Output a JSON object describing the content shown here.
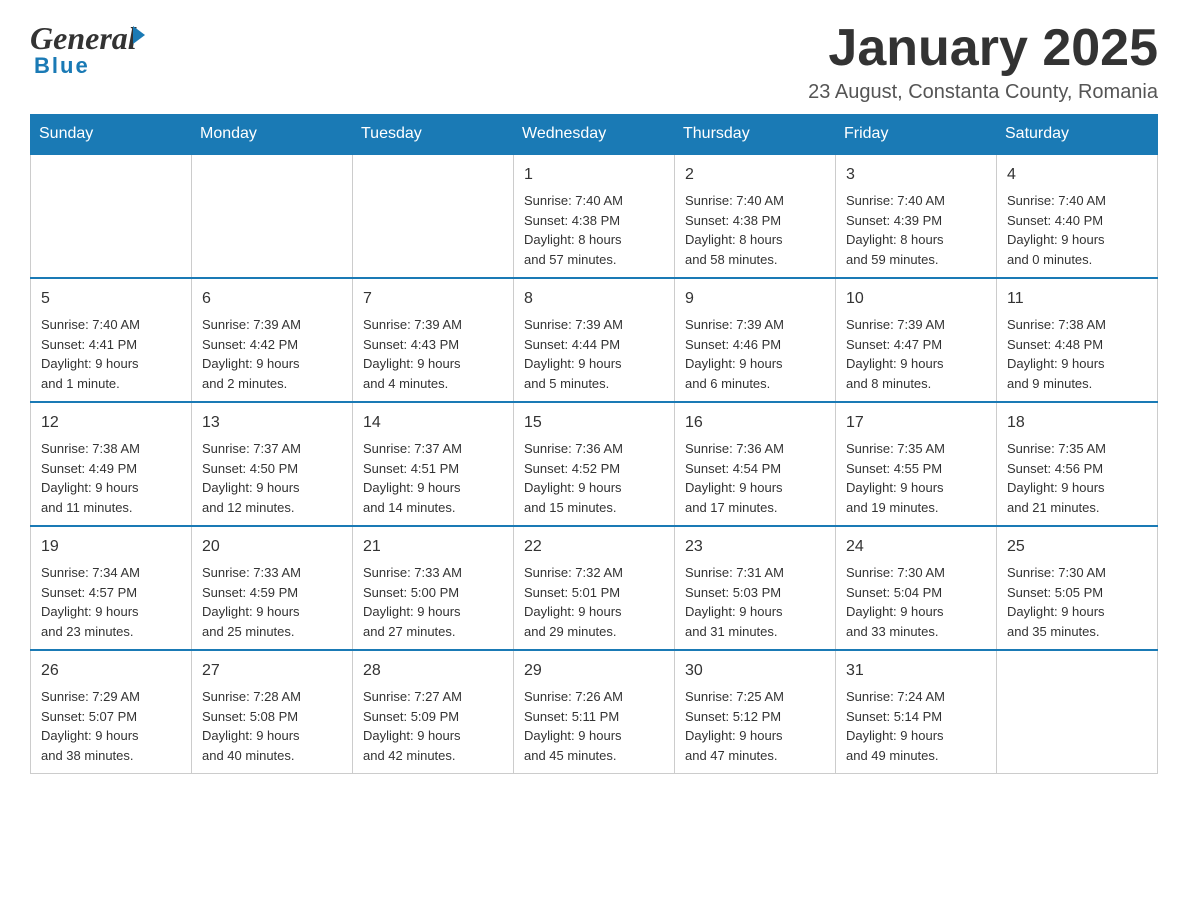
{
  "logo": {
    "general": "General",
    "blue": "Blue"
  },
  "header": {
    "month_year": "January 2025",
    "location": "23 August, Constanta County, Romania"
  },
  "weekdays": [
    "Sunday",
    "Monday",
    "Tuesday",
    "Wednesday",
    "Thursday",
    "Friday",
    "Saturday"
  ],
  "weeks": [
    {
      "days": [
        {
          "date": "",
          "info": ""
        },
        {
          "date": "",
          "info": ""
        },
        {
          "date": "",
          "info": ""
        },
        {
          "date": "1",
          "info": "Sunrise: 7:40 AM\nSunset: 4:38 PM\nDaylight: 8 hours\nand 57 minutes."
        },
        {
          "date": "2",
          "info": "Sunrise: 7:40 AM\nSunset: 4:38 PM\nDaylight: 8 hours\nand 58 minutes."
        },
        {
          "date": "3",
          "info": "Sunrise: 7:40 AM\nSunset: 4:39 PM\nDaylight: 8 hours\nand 59 minutes."
        },
        {
          "date": "4",
          "info": "Sunrise: 7:40 AM\nSunset: 4:40 PM\nDaylight: 9 hours\nand 0 minutes."
        }
      ]
    },
    {
      "days": [
        {
          "date": "5",
          "info": "Sunrise: 7:40 AM\nSunset: 4:41 PM\nDaylight: 9 hours\nand 1 minute."
        },
        {
          "date": "6",
          "info": "Sunrise: 7:39 AM\nSunset: 4:42 PM\nDaylight: 9 hours\nand 2 minutes."
        },
        {
          "date": "7",
          "info": "Sunrise: 7:39 AM\nSunset: 4:43 PM\nDaylight: 9 hours\nand 4 minutes."
        },
        {
          "date": "8",
          "info": "Sunrise: 7:39 AM\nSunset: 4:44 PM\nDaylight: 9 hours\nand 5 minutes."
        },
        {
          "date": "9",
          "info": "Sunrise: 7:39 AM\nSunset: 4:46 PM\nDaylight: 9 hours\nand 6 minutes."
        },
        {
          "date": "10",
          "info": "Sunrise: 7:39 AM\nSunset: 4:47 PM\nDaylight: 9 hours\nand 8 minutes."
        },
        {
          "date": "11",
          "info": "Sunrise: 7:38 AM\nSunset: 4:48 PM\nDaylight: 9 hours\nand 9 minutes."
        }
      ]
    },
    {
      "days": [
        {
          "date": "12",
          "info": "Sunrise: 7:38 AM\nSunset: 4:49 PM\nDaylight: 9 hours\nand 11 minutes."
        },
        {
          "date": "13",
          "info": "Sunrise: 7:37 AM\nSunset: 4:50 PM\nDaylight: 9 hours\nand 12 minutes."
        },
        {
          "date": "14",
          "info": "Sunrise: 7:37 AM\nSunset: 4:51 PM\nDaylight: 9 hours\nand 14 minutes."
        },
        {
          "date": "15",
          "info": "Sunrise: 7:36 AM\nSunset: 4:52 PM\nDaylight: 9 hours\nand 15 minutes."
        },
        {
          "date": "16",
          "info": "Sunrise: 7:36 AM\nSunset: 4:54 PM\nDaylight: 9 hours\nand 17 minutes."
        },
        {
          "date": "17",
          "info": "Sunrise: 7:35 AM\nSunset: 4:55 PM\nDaylight: 9 hours\nand 19 minutes."
        },
        {
          "date": "18",
          "info": "Sunrise: 7:35 AM\nSunset: 4:56 PM\nDaylight: 9 hours\nand 21 minutes."
        }
      ]
    },
    {
      "days": [
        {
          "date": "19",
          "info": "Sunrise: 7:34 AM\nSunset: 4:57 PM\nDaylight: 9 hours\nand 23 minutes."
        },
        {
          "date": "20",
          "info": "Sunrise: 7:33 AM\nSunset: 4:59 PM\nDaylight: 9 hours\nand 25 minutes."
        },
        {
          "date": "21",
          "info": "Sunrise: 7:33 AM\nSunset: 5:00 PM\nDaylight: 9 hours\nand 27 minutes."
        },
        {
          "date": "22",
          "info": "Sunrise: 7:32 AM\nSunset: 5:01 PM\nDaylight: 9 hours\nand 29 minutes."
        },
        {
          "date": "23",
          "info": "Sunrise: 7:31 AM\nSunset: 5:03 PM\nDaylight: 9 hours\nand 31 minutes."
        },
        {
          "date": "24",
          "info": "Sunrise: 7:30 AM\nSunset: 5:04 PM\nDaylight: 9 hours\nand 33 minutes."
        },
        {
          "date": "25",
          "info": "Sunrise: 7:30 AM\nSunset: 5:05 PM\nDaylight: 9 hours\nand 35 minutes."
        }
      ]
    },
    {
      "days": [
        {
          "date": "26",
          "info": "Sunrise: 7:29 AM\nSunset: 5:07 PM\nDaylight: 9 hours\nand 38 minutes."
        },
        {
          "date": "27",
          "info": "Sunrise: 7:28 AM\nSunset: 5:08 PM\nDaylight: 9 hours\nand 40 minutes."
        },
        {
          "date": "28",
          "info": "Sunrise: 7:27 AM\nSunset: 5:09 PM\nDaylight: 9 hours\nand 42 minutes."
        },
        {
          "date": "29",
          "info": "Sunrise: 7:26 AM\nSunset: 5:11 PM\nDaylight: 9 hours\nand 45 minutes."
        },
        {
          "date": "30",
          "info": "Sunrise: 7:25 AM\nSunset: 5:12 PM\nDaylight: 9 hours\nand 47 minutes."
        },
        {
          "date": "31",
          "info": "Sunrise: 7:24 AM\nSunset: 5:14 PM\nDaylight: 9 hours\nand 49 minutes."
        },
        {
          "date": "",
          "info": ""
        }
      ]
    }
  ]
}
